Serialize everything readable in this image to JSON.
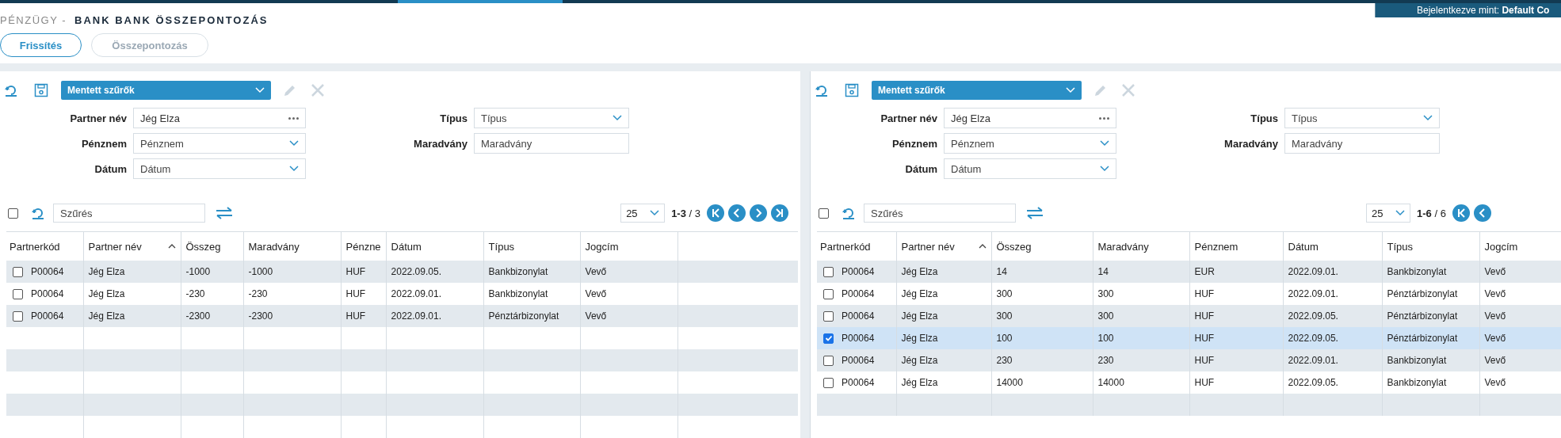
{
  "header": {
    "breadcrumb": "PÉNZÜGY -",
    "title": "BANK BANK ÖSSZEPONTOZÁS",
    "login": "Bejelentkezve mint: **Default Co**",
    "buttons": [
      {
        "label": "Frissítés",
        "disabled": false
      },
      {
        "label": "Összepontozás",
        "disabled": true
      }
    ]
  },
  "panels": [
    {
      "saved_filters": "Mentett szűrők",
      "filters": [
        {
          "label": "Partner név",
          "kind": "lookup",
          "value": "Jég Elza"
        },
        {
          "label": "Pénznem",
          "kind": "select",
          "placeholder": "Pénznem"
        },
        {
          "label": "Dátum",
          "kind": "select",
          "placeholder": "Dátum"
        },
        {
          "label": "Típus",
          "kind": "select",
          "placeholder": "Típus"
        },
        {
          "label": "Maradvány",
          "kind": "text",
          "placeholder": "Maradvány"
        }
      ],
      "search": {
        "placeholder": "Szűrés"
      },
      "page_size": "25",
      "range": "1-3",
      "total": "/ 3",
      "all_checked": false,
      "pager": [
        {
          "kind": "first"
        },
        {
          "kind": "prev"
        },
        {
          "kind": "next"
        },
        {
          "kind": "last"
        }
      ],
      "columns": [
        "Partnerkód",
        "Partner név",
        "Összeg",
        "Maradvány",
        "Pénzne",
        "Dátum",
        "Típus",
        "Jogcím"
      ],
      "rows": [
        {
          "checked": false,
          "selected": false,
          "cells": [
            "P00064",
            "Jég Elza",
            "-1000",
            "-1000",
            "HUF",
            "2022.09.05.",
            "Bankbizonylat",
            "Vevő"
          ]
        },
        {
          "checked": false,
          "selected": false,
          "cells": [
            "P00064",
            "Jég Elza",
            "-230",
            "-230",
            "HUF",
            "2022.09.01.",
            "Bankbizonylat",
            "Vevő"
          ]
        },
        {
          "checked": false,
          "selected": false,
          "cells": [
            "P00064",
            "Jég Elza",
            "-2300",
            "-2300",
            "HUF",
            "2022.09.01.",
            "Pénztárbizonylat",
            "Vevő"
          ]
        }
      ]
    },
    {
      "saved_filters": "Mentett szűrők",
      "filters": [
        {
          "label": "Partner név",
          "kind": "lookup",
          "value": "Jég Elza"
        },
        {
          "label": "Pénznem",
          "kind": "select",
          "placeholder": "Pénznem"
        },
        {
          "label": "Dátum",
          "kind": "select",
          "placeholder": "Dátum"
        },
        {
          "label": "Típus",
          "kind": "select",
          "placeholder": "Típus"
        },
        {
          "label": "Maradvány",
          "kind": "text",
          "placeholder": "Maradvány"
        }
      ],
      "search": {
        "placeholder": "Szűrés"
      },
      "page_size": "25",
      "range": "1-6",
      "total": "/ 6",
      "all_checked": false,
      "pager": [
        {
          "kind": "first"
        },
        {
          "kind": "prev"
        }
      ],
      "columns": [
        "Partnerkód",
        "Partner név",
        "Összeg",
        "Maradvány",
        "Pénznem",
        "Dátum",
        "Típus",
        "Jogcím"
      ],
      "rows": [
        {
          "checked": false,
          "selected": false,
          "cells": [
            "P00064",
            "Jég Elza",
            "14",
            "14",
            "EUR",
            "2022.09.01.",
            "Bankbizonylat",
            "Vevő"
          ]
        },
        {
          "checked": false,
          "selected": false,
          "cells": [
            "P00064",
            "Jég Elza",
            "300",
            "300",
            "HUF",
            "2022.09.01.",
            "Pénztárbizonylat",
            "Vevő"
          ]
        },
        {
          "checked": false,
          "selected": false,
          "cells": [
            "P00064",
            "Jég Elza",
            "300",
            "300",
            "HUF",
            "2022.09.05.",
            "Pénztárbizonylat",
            "Vevő"
          ]
        },
        {
          "checked": true,
          "selected": true,
          "cells": [
            "P00064",
            "Jég Elza",
            "100",
            "100",
            "HUF",
            "2022.09.05.",
            "Pénztárbizonylat",
            "Vevő"
          ]
        },
        {
          "checked": false,
          "selected": false,
          "cells": [
            "P00064",
            "Jég Elza",
            "230",
            "230",
            "HUF",
            "2022.09.01.",
            "Bankbizonylat",
            "Vevő"
          ]
        },
        {
          "checked": false,
          "selected": false,
          "cells": [
            "P00064",
            "Jég Elza",
            "14000",
            "14000",
            "HUF",
            "2022.09.05.",
            "Bankbizonylat",
            "Vevő"
          ]
        }
      ]
    }
  ]
}
